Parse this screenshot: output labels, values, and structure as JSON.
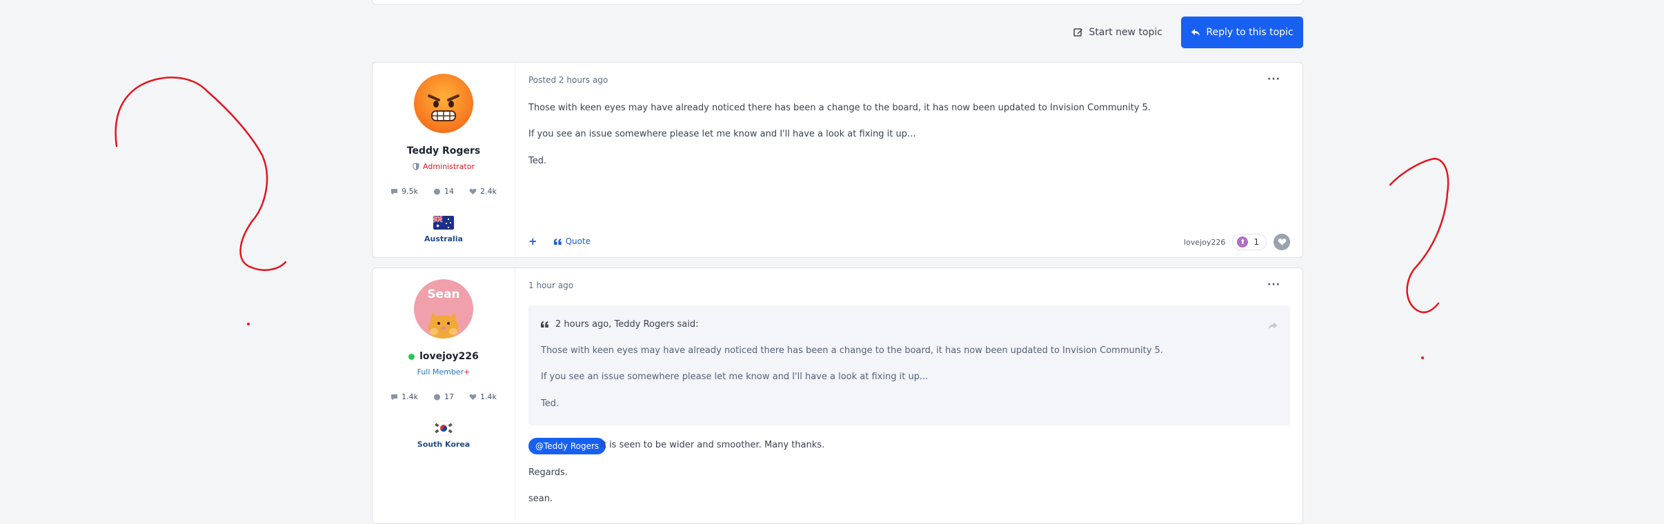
{
  "colors": {
    "accent": "#1760f2",
    "admin": "#e3141c",
    "member": "#1f74c9",
    "annotation": "#e3141c",
    "online": "#2ec15a"
  },
  "actions": {
    "start_topic": "Start new topic",
    "reply_topic": "Reply to this topic"
  },
  "posts": [
    {
      "author": {
        "name": "Teddy Rogers",
        "role": "Administrator",
        "stats": {
          "posts": "9.5k",
          "comments": "14",
          "likes": "2.4k"
        },
        "country": "Australia",
        "avatar_icon": "angry-face-emoji-avatar"
      },
      "meta": "Posted 2 hours ago",
      "paragraphs": [
        "Those with keen eyes may have already noticed there has been a change to the board, it has now been updated to Invision Community 5.",
        "If you see an issue somewhere please let me know and I'll have a look at fixing it up...",
        "Ted."
      ],
      "footer": {
        "plus": "+",
        "quote": "Quote",
        "reacted_by": "lovejoy226",
        "reaction_count": "1"
      }
    },
    {
      "author": {
        "name": "lovejoy226",
        "role": "Full Member",
        "role_suffix": "+",
        "stats": {
          "posts": "1.4k",
          "comments": "17",
          "likes": "1.4k"
        },
        "country": "South Korea",
        "avatar_text": "Sean"
      },
      "meta": "1 hour ago",
      "quote": {
        "header": "2 hours ago, Teddy Rogers said:",
        "paragraphs": [
          "Those with keen eyes may have already noticed there has been a change to the board, it has now been updated to Invision Community 5.",
          "If you see an issue somewhere please let me know and I'll have a look at fixing it up...",
          "Ted."
        ]
      },
      "mention": "@Teddy Rogers",
      "mention_rest": " It is seen to be wider and smoother. Many thanks.",
      "paragraphs": [
        "Regards.",
        "sean."
      ]
    }
  ]
}
